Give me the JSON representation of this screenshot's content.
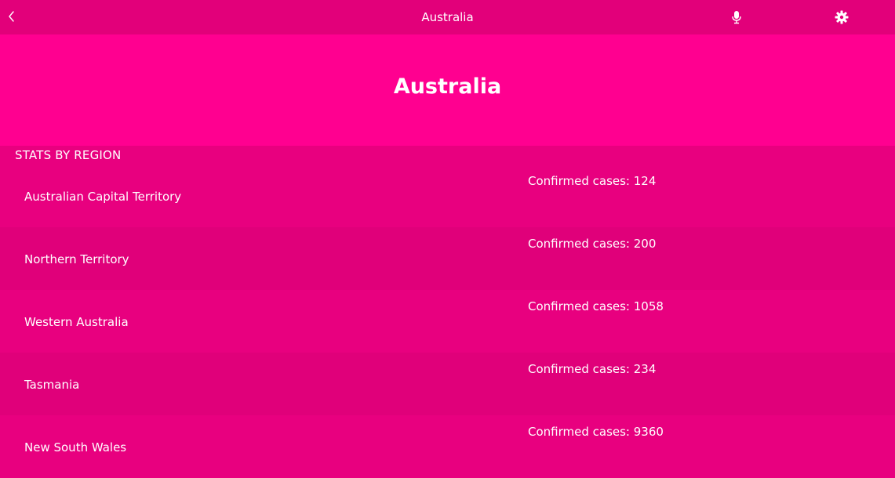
{
  "topbar": {
    "title": "Australia",
    "icons": [
      "chevron-left-icon",
      "microphone-icon",
      "gear-icon"
    ]
  },
  "header": {
    "title": "Australia"
  },
  "section": {
    "label": "STATS BY REGION"
  },
  "regions": [
    {
      "name": "Australian Capital Territory",
      "cases": "Confirmed cases: 124"
    },
    {
      "name": "Northern Territory",
      "cases": "Confirmed cases: 200"
    },
    {
      "name": "Western Australia",
      "cases": "Confirmed cases: 1058"
    },
    {
      "name": "Tasmania",
      "cases": "Confirmed cases: 234"
    },
    {
      "name": "New South Wales",
      "cases": "Confirmed cases: 9360"
    }
  ],
  "colors": {
    "topbar": "#e2007a",
    "header": "#ff0090",
    "row_light": "#e8007f",
    "row_dark": "#e0007a",
    "text": "#ffffff"
  }
}
